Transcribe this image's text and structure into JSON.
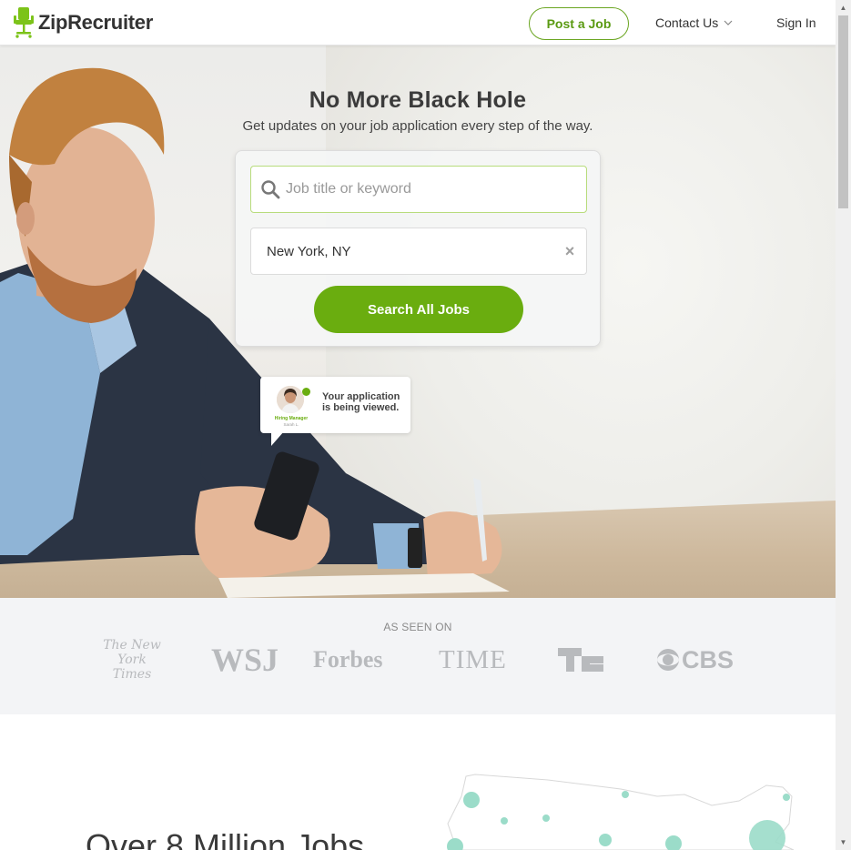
{
  "header": {
    "logo_text": "ZipRecruiter",
    "post_job_label": "Post a Job",
    "contact_label": "Contact Us",
    "signin_label": "Sign In"
  },
  "hero": {
    "title": "No More Black Hole",
    "subtitle": "Get updates on your job application every step of the way.",
    "search": {
      "keyword_placeholder": "Job title or keyword",
      "keyword_value": "",
      "location_value": "New York, NY",
      "search_button_label": "Search All Jobs"
    },
    "notification": {
      "message": "Your application is being viewed.",
      "role": "Hiring Manager",
      "name": "Sarah L."
    }
  },
  "press": {
    "label": "AS SEEN ON",
    "logos": {
      "nyt": "The New York Times",
      "wsj": "WSJ",
      "forbes": "Forbes",
      "time": "TIME",
      "techcrunch": "TC",
      "cbs": "CBS"
    }
  },
  "lower": {
    "headline": "Over 8 Million Jobs"
  },
  "colors": {
    "brand_green": "#6aad0f",
    "text_dark": "#333333",
    "press_gray": "#b8babd"
  }
}
